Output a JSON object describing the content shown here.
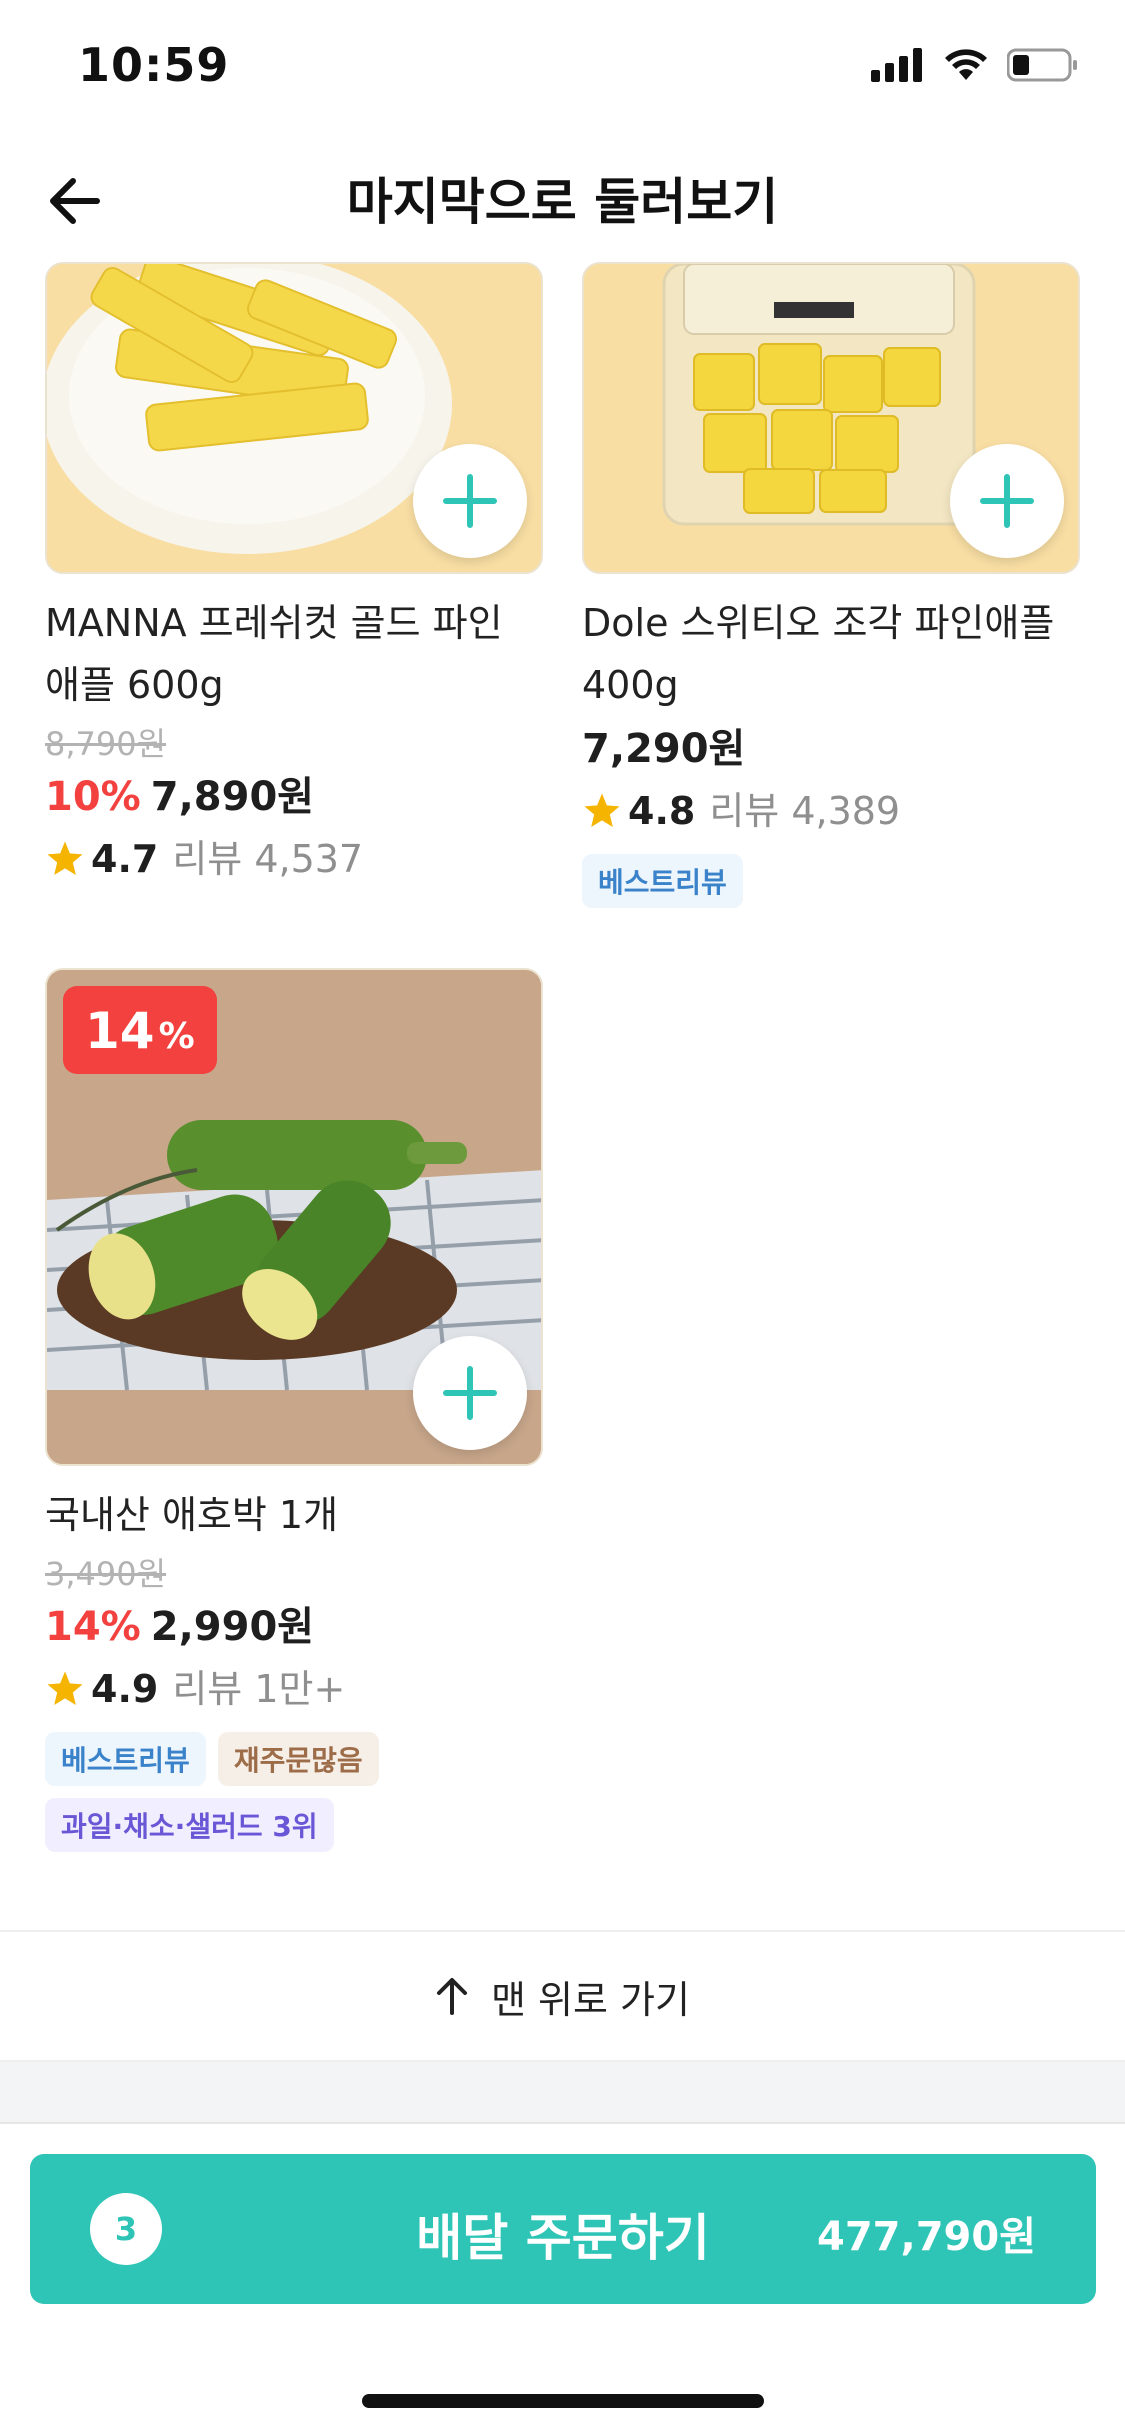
{
  "status_bar": {
    "time": "10:59"
  },
  "header": {
    "title": "마지막으로 둘러보기"
  },
  "products": [
    {
      "name_line1": "MANNA 프레쉬컷 골드 파인",
      "name_line2": "애플 600g",
      "original_price": "8,790원",
      "discount_rate": "10%",
      "price": "7,890원",
      "rating": "4.7",
      "reviews": "리뷰 4,537"
    },
    {
      "name_line1": "Dole 스위티오 조각 파인애플",
      "name_line2": "400g",
      "price": "7,290원",
      "rating": "4.8",
      "reviews": "리뷰 4,389",
      "tags": [
        "베스트리뷰"
      ]
    },
    {
      "badge_num": "14",
      "badge_pct": "%",
      "name_line1": "국내산 애호박 1개",
      "original_price": "3,490원",
      "discount_rate": "14%",
      "price": "2,990원",
      "rating": "4.9",
      "reviews": "리뷰 1만+",
      "tags": [
        "베스트리뷰",
        "재주문많음",
        "과일·채소·샐러드 3위"
      ]
    }
  ],
  "scroll_top": {
    "label": "맨 위로 가기"
  },
  "order_bar": {
    "count": "3",
    "label": "배달 주문하기",
    "total": "477,790원"
  },
  "colors": {
    "accent": "#2ec4b6",
    "discount": "#f2413e",
    "star": "#f5b400"
  }
}
